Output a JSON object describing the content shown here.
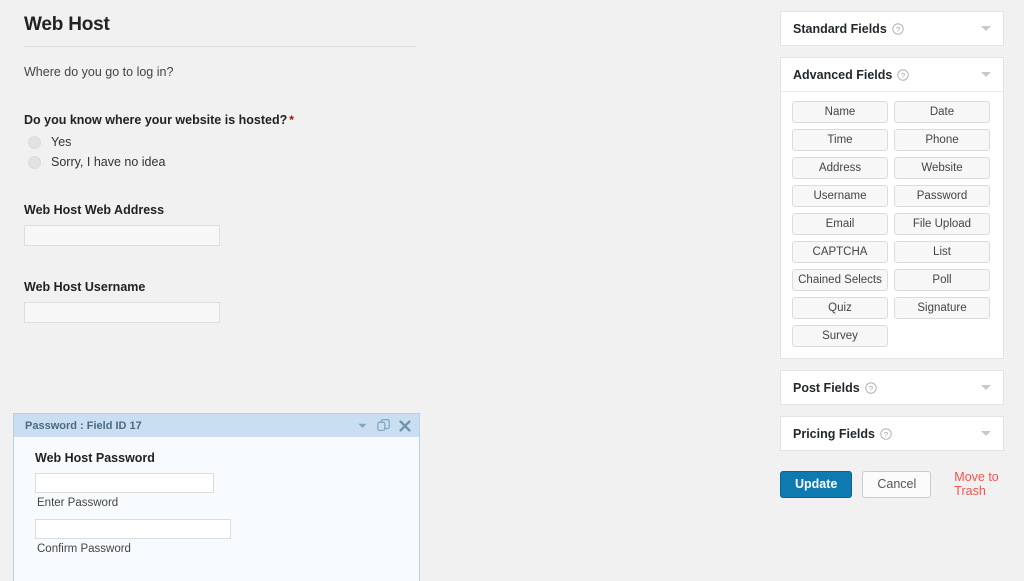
{
  "form": {
    "title": "Web Host",
    "description": "Where do you go to log in?",
    "fields": [
      {
        "label": "Do you know where your website is hosted?",
        "required_marker": "*",
        "type": "radio",
        "options": [
          "Yes",
          "Sorry, I have no idea"
        ]
      },
      {
        "label": "Web Host Web Address",
        "type": "text",
        "value": "",
        "placeholder": ""
      },
      {
        "label": "Web Host Username",
        "type": "text",
        "value": "",
        "placeholder": ""
      }
    ]
  },
  "selected_field": {
    "header_title": "Password : Field ID 17",
    "label": "Web Host Password",
    "icons": {
      "collapse": "chevron-down-icon",
      "duplicate": "duplicate-icon",
      "delete": "close-icon"
    },
    "inputs": [
      {
        "sub_label": "Enter Password",
        "value": "",
        "placeholder": ""
      },
      {
        "sub_label": "Confirm Password",
        "value": "",
        "placeholder": ""
      }
    ]
  },
  "sidebar": {
    "panels": [
      {
        "title": "Standard Fields",
        "help_icon": "help-circle-icon",
        "toggle_icon": "chevron-down-icon",
        "expanded": false,
        "buttons": []
      },
      {
        "title": "Advanced Fields",
        "help_icon": "help-circle-icon",
        "toggle_icon": "chevron-down-icon",
        "expanded": true,
        "buttons": [
          "Name",
          "Date",
          "Time",
          "Phone",
          "Address",
          "Website",
          "Username",
          "Password",
          "Email",
          "File Upload",
          "CAPTCHA",
          "List",
          "Chained Selects",
          "Poll",
          "Quiz",
          "Signature",
          "Survey"
        ]
      },
      {
        "title": "Post Fields",
        "help_icon": "help-circle-icon",
        "toggle_icon": "chevron-down-icon",
        "expanded": false,
        "buttons": []
      },
      {
        "title": "Pricing Fields",
        "help_icon": "help-circle-icon",
        "toggle_icon": "chevron-down-icon",
        "expanded": false,
        "buttons": []
      }
    ],
    "actions": {
      "update_label": "Update",
      "cancel_label": "Cancel",
      "trash_label": "Move to Trash"
    }
  },
  "colors": {
    "page_bg": "#f1f1f1",
    "primary_button": "#0e7ab0",
    "danger_link": "#f4534d",
    "selected_header": "#c9def0",
    "selected_body": "#f7fbfd",
    "required_star": "#cc0000"
  }
}
